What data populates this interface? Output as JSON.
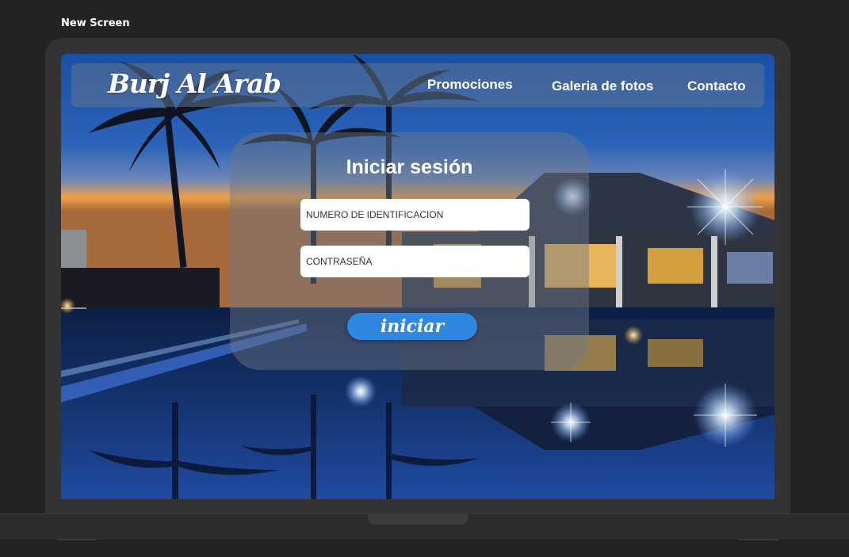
{
  "canvas": {
    "label": "New Screen"
  },
  "nav": {
    "brand": "Burj Al Arab",
    "links": [
      {
        "label": "Promociones"
      },
      {
        "label": "Galeria de fotos"
      },
      {
        "label": "Contacto"
      }
    ]
  },
  "login": {
    "title": "Iniciar sesión",
    "id_placeholder": "NUMERO DE IDENTIFICACION",
    "password_placeholder": "CONTRASEÑA",
    "submit_label": "iniciar"
  },
  "colors": {
    "background": "#232323",
    "nav_bar": "#5f7391",
    "accent_button": "#2f87e0",
    "sky": "#1d4fa0",
    "sunset": "#f39a3d"
  },
  "background_image": {
    "description_icon": "resort-pool-night-photo"
  }
}
